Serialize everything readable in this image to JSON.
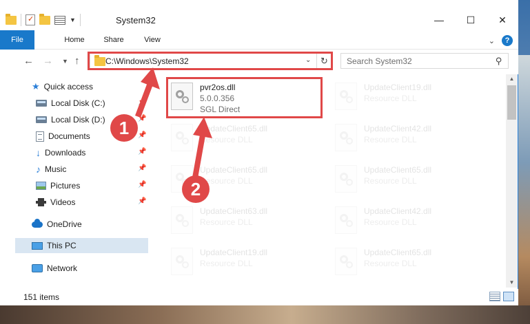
{
  "window": {
    "title": "System32",
    "controls": {
      "minimize": "—",
      "maximize": "☐",
      "close": "✕"
    }
  },
  "ribbon": {
    "tabs": [
      "File",
      "Home",
      "Share",
      "View"
    ],
    "help": "?"
  },
  "address": {
    "path": "C:\\Windows\\System32"
  },
  "search": {
    "placeholder": "Search System32"
  },
  "sidebar": {
    "items": [
      {
        "label": "Quick access",
        "icon": "quick-access-star-icon",
        "pinned": false
      },
      {
        "label": "Local Disk (C:)",
        "icon": "drive-icon",
        "pinned": true
      },
      {
        "label": "Local Disk (D:)",
        "icon": "drive-icon",
        "pinned": true
      },
      {
        "label": "Documents",
        "icon": "documents-icon",
        "pinned": true
      },
      {
        "label": "Downloads",
        "icon": "downloads-icon",
        "pinned": true
      },
      {
        "label": "Music",
        "icon": "music-icon",
        "pinned": true
      },
      {
        "label": "Pictures",
        "icon": "pictures-icon",
        "pinned": true
      },
      {
        "label": "Videos",
        "icon": "videos-icon",
        "pinned": true
      },
      {
        "label": "OneDrive",
        "icon": "onedrive-icon",
        "pinned": false
      },
      {
        "label": "This PC",
        "icon": "this-pc-icon",
        "pinned": false,
        "selected": true
      },
      {
        "label": "Network",
        "icon": "network-icon",
        "pinned": false
      }
    ]
  },
  "files": [
    {
      "name": "pvr2os.dll",
      "version": "5.0.0.356",
      "company": "SGL Direct",
      "highlighted": true
    },
    {
      "name": "UpdateClient19.dll",
      "version": "Resource DLL",
      "company": ""
    },
    {
      "name": "UpdateClient65.dll",
      "version": "Resource DLL",
      "company": ""
    },
    {
      "name": "UpdateClient42.dll",
      "version": "Resource DLL",
      "company": ""
    },
    {
      "name": "UpdateClient65.dll",
      "version": "Resource DLL",
      "company": ""
    },
    {
      "name": "UpdateClient65.dll",
      "version": "Resource DLL",
      "company": ""
    },
    {
      "name": "UpdateClient63.dll",
      "version": "Resource DLL",
      "company": ""
    },
    {
      "name": "UpdateClient42.dll",
      "version": "Resource DLL",
      "company": ""
    },
    {
      "name": "UpdateClient19.dll",
      "version": "Resource DLL",
      "company": ""
    },
    {
      "name": "UpdateClient65.dll",
      "version": "Resource DLL",
      "company": ""
    }
  ],
  "status": {
    "item_count": "151 items"
  },
  "annotations": {
    "marker1": "1",
    "marker2": "2",
    "color": "#e04848"
  }
}
